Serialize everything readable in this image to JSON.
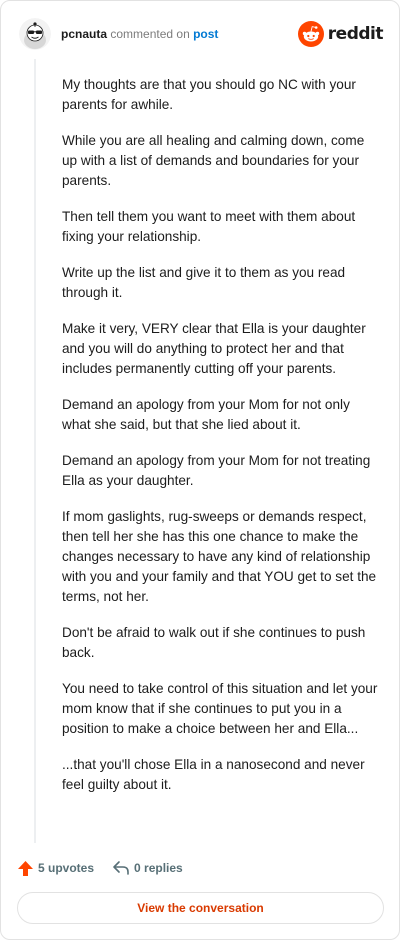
{
  "header": {
    "username": "pcnauta",
    "verb": "commented on",
    "target": "post",
    "brand": "reddit",
    "brand_color": "#ff4500",
    "link_color": "#0079d3"
  },
  "comment": {
    "paragraphs": [
      "My thoughts are that you should go NC with your parents for awhile.",
      "While you are all healing and calming down, come up with a list of demands and boundaries for your parents.",
      "Then tell them you want to meet with them about fixing your relationship.",
      "Write up the list and give it to them as you read through it.",
      "Make it very, VERY clear that Ella is your daughter and you will do anything to protect her and that includes permanently cutting off your parents.",
      "Demand an apology from your Mom for not only what she said, but that she lied about it.",
      "Demand an apology from your Mom for not treating Ella as your daughter.",
      "If mom gaslights, rug-sweeps or demands respect, then tell her she has this one chance to make the changes necessary to have any kind of relationship with you and your family and that YOU get to set the terms, not her.",
      "Don't be afraid to walk out if she continues to push back.",
      "You need to take control of this situation and let your mom know that if she continues to put you in a position to make a choice between her and Ella...",
      "...that you'll chose Ella in a nanosecond and never feel guilty about it."
    ]
  },
  "actions": {
    "upvotes": "5 upvotes",
    "replies": "0 replies",
    "upvote_icon": "upvote-arrow-icon",
    "reply_icon": "reply-arrow-icon"
  },
  "cta": {
    "label": "View the conversation"
  }
}
